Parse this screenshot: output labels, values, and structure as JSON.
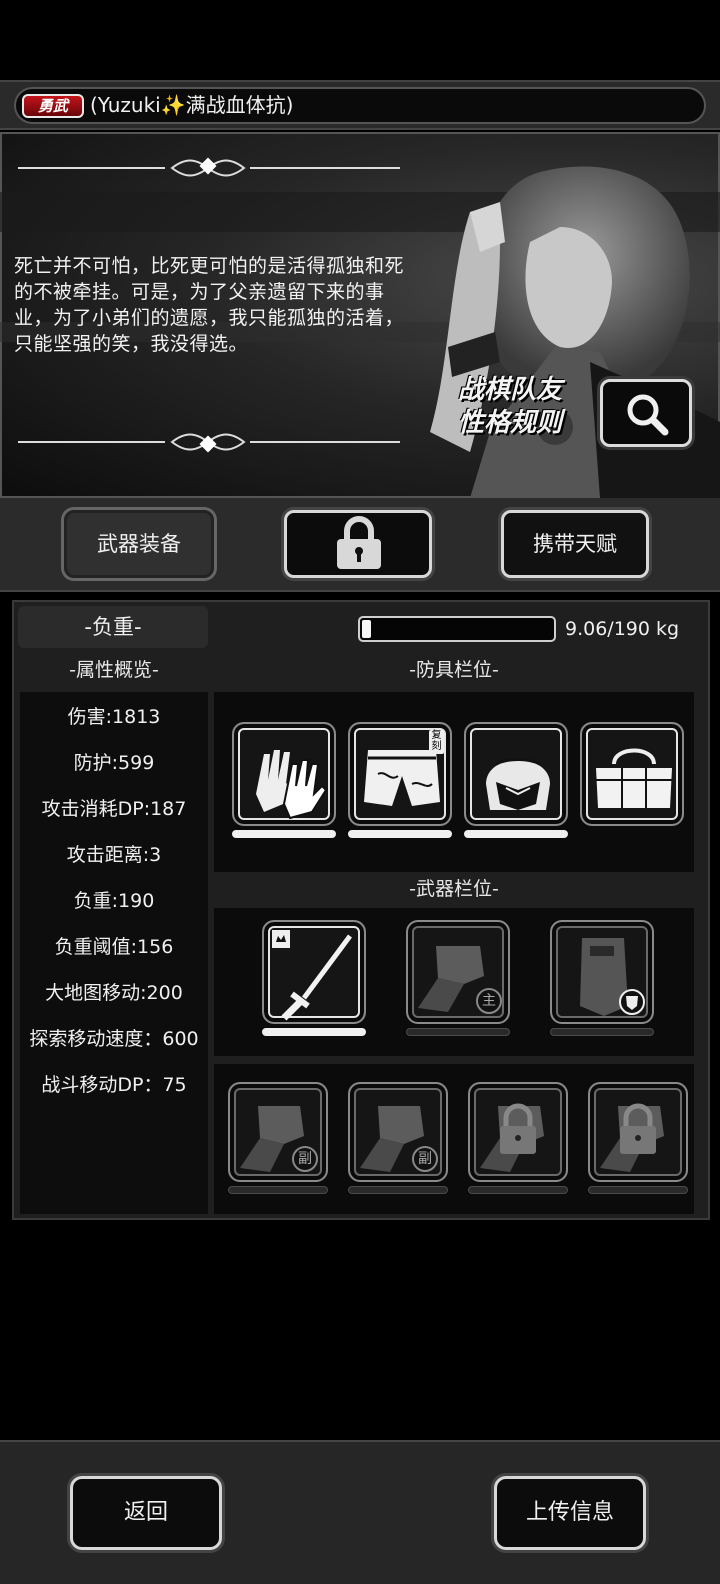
{
  "header": {
    "badge": "勇武",
    "name": "(Yuzuki✨满战血体抗)"
  },
  "story": {
    "quote": "死亡并不可怕，比死更可怕的是活得孤独和死的不被牵挂。可是，为了父亲遗留下来的事业，为了小弟们的遗愿，我只能孤独的活着，只能坚强的笑，我没得选。",
    "rules_line1": "战棋队友",
    "rules_line2": "性格规则",
    "search_icon": "magnifier-icon"
  },
  "tabs": [
    {
      "label": "武器装备",
      "active": true
    },
    {
      "label": "",
      "locked": true,
      "icon": "lock-icon"
    },
    {
      "label": "携带天赋",
      "active": false
    }
  ],
  "weight": {
    "label": "-负重-",
    "current": 9.06,
    "max": 190,
    "text": "9.06/190 kg",
    "fill_fraction": 0.048
  },
  "stats": {
    "title": "-属性概览-",
    "items": [
      "伤害:1813",
      "防护:599",
      "攻击消耗DP:187",
      "攻击距离:3",
      "负重:190",
      "负重阈值:156",
      "大地图移动:200",
      "探索移动速度：600",
      "战斗移动DP：75"
    ]
  },
  "armor": {
    "title": "-防具栏位-",
    "slots": [
      {
        "icon": "gloves-icon",
        "durability": 1
      },
      {
        "icon": "shorts-icon",
        "durability": 1,
        "stamp": "复刻"
      },
      {
        "icon": "helmet-icon",
        "durability": 1
      },
      {
        "icon": "duffel-bag-icon"
      }
    ]
  },
  "weapons": {
    "title": "-武器栏位-",
    "main_slots": [
      {
        "icon": "katana-icon",
        "durability": 1,
        "tag_icon": "fist-tag-icon"
      },
      {
        "icon": "fist-icon",
        "badge": "主",
        "durability": 0
      },
      {
        "icon": "riot-shield-icon",
        "durability": 0,
        "badge_icon": "shield-badge-icon"
      }
    ],
    "sub_slots": [
      {
        "icon": "fist-icon",
        "badge": "副"
      },
      {
        "icon": "fist-icon",
        "badge": "副"
      },
      {
        "icon": "fist-lock-icon"
      },
      {
        "icon": "fist-lock-icon"
      }
    ]
  },
  "footer": {
    "back": "返回",
    "upload": "上传信息"
  }
}
